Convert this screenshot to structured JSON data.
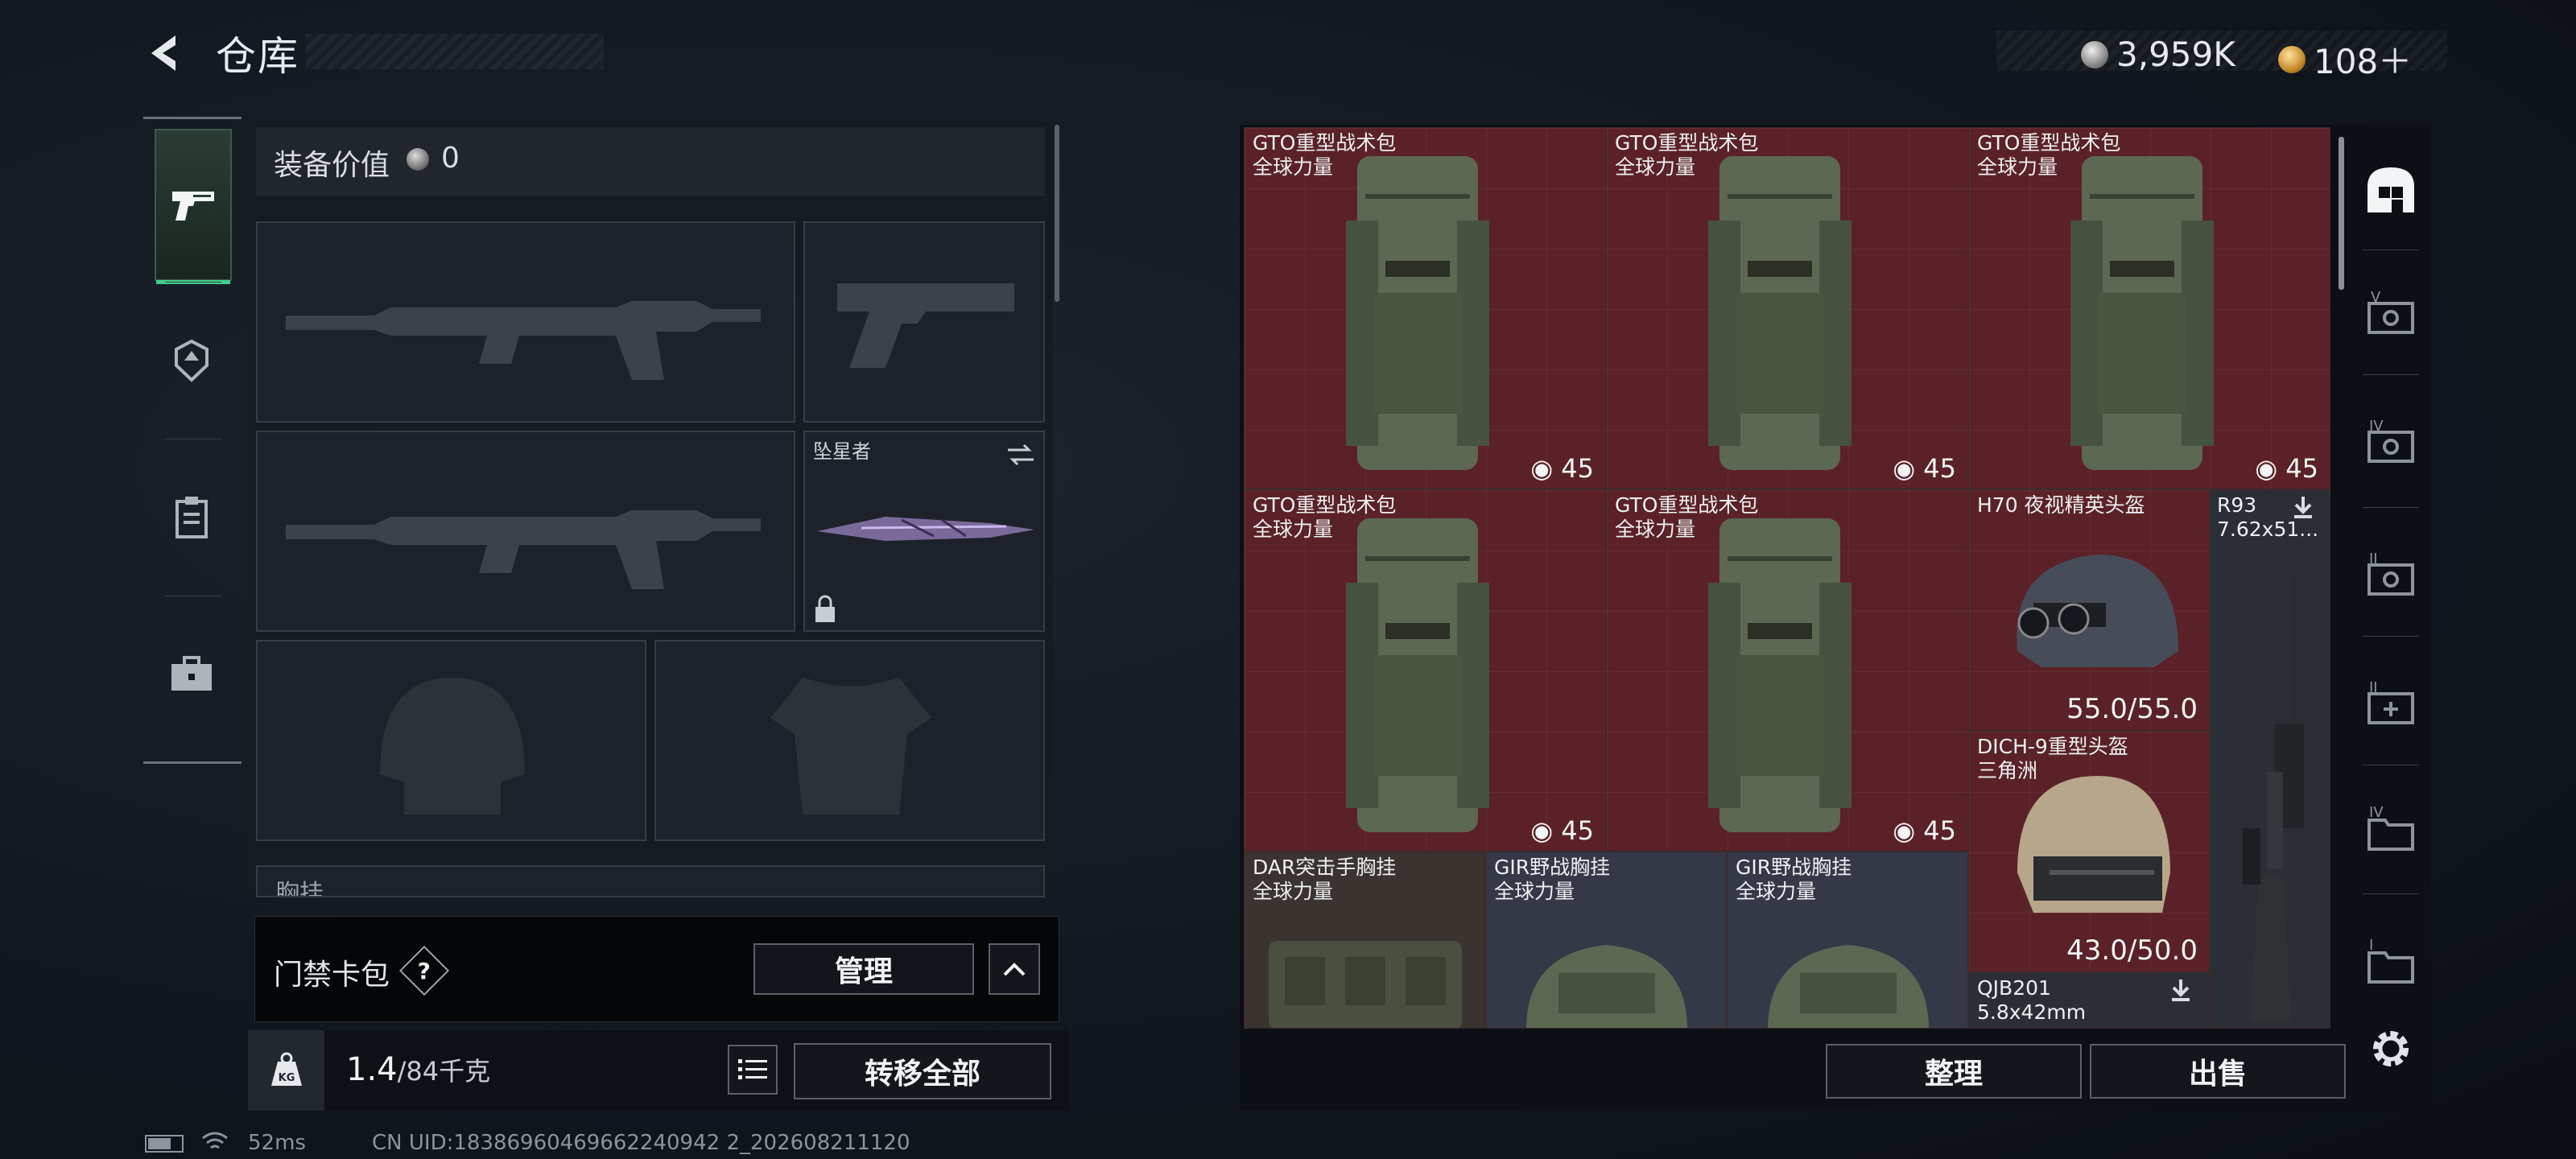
{
  "header": {
    "title": "仓库",
    "currency_amount": "3,959K",
    "tickets": "108＋"
  },
  "categories": [
    {
      "icon": "pistol-icon",
      "active": true
    },
    {
      "icon": "armor-badge-icon",
      "active": false
    },
    {
      "icon": "clipboard-icon",
      "active": false
    },
    {
      "icon": "briefcase-icon",
      "active": false
    }
  ],
  "equipment": {
    "value_label": "装备价值",
    "value": "0",
    "melee_name": "坠星者",
    "chest_rig_label": "胸挂",
    "keycard_label": "门禁卡包",
    "manage_label": "管理",
    "weight_value": "1.4",
    "weight_capacity": "/84千克",
    "weight_icon_text": "KG",
    "transfer_all_label": "转移全部"
  },
  "storage": {
    "items": [
      {
        "name": "GTO重型战术包",
        "sub": "全球力量",
        "count": "45"
      },
      {
        "name": "GTO重型战术包",
        "sub": "全球力量",
        "count": "45"
      },
      {
        "name": "GTO重型战术包",
        "sub": "全球力量",
        "count": "45"
      },
      {
        "name": "GTO重型战术包",
        "sub": "全球力量",
        "count": "45"
      },
      {
        "name": "GTO重型战术包",
        "sub": "全球力量",
        "count": "45"
      },
      {
        "name": "H70 夜视精英头盔",
        "durability": "55.0/55.0"
      },
      {
        "name": "R93",
        "sub": "7.62x51..."
      },
      {
        "name": "DICH-9重型头盔",
        "sub": "三角洲",
        "durability": "43.0/50.0"
      },
      {
        "name": "DAR突击手胸挂",
        "sub": "全球力量"
      },
      {
        "name": "GIR野战胸挂",
        "sub": "全球力量"
      },
      {
        "name": "GIR野战胸挂",
        "sub": "全球力量"
      },
      {
        "name": "QJB201",
        "sub": "5.8x42mm"
      }
    ],
    "sort_label": "整理",
    "sell_label": "出售"
  },
  "side_tools": [
    "home-icon",
    "tier-v-icon",
    "tier-iv-icon",
    "tier-ii-icon",
    "tier-ii-add-icon",
    "tier-iv-folder-icon",
    "tier-i-folder-icon",
    "settings-icon"
  ],
  "status": {
    "ping": "52ms",
    "uid": "CN UID:18386960469662240942 2_202608211120"
  },
  "colors": {
    "accent_green": "#3fd08c",
    "cell_red": "#5a2228",
    "panel_dark": "#0c0f13"
  }
}
